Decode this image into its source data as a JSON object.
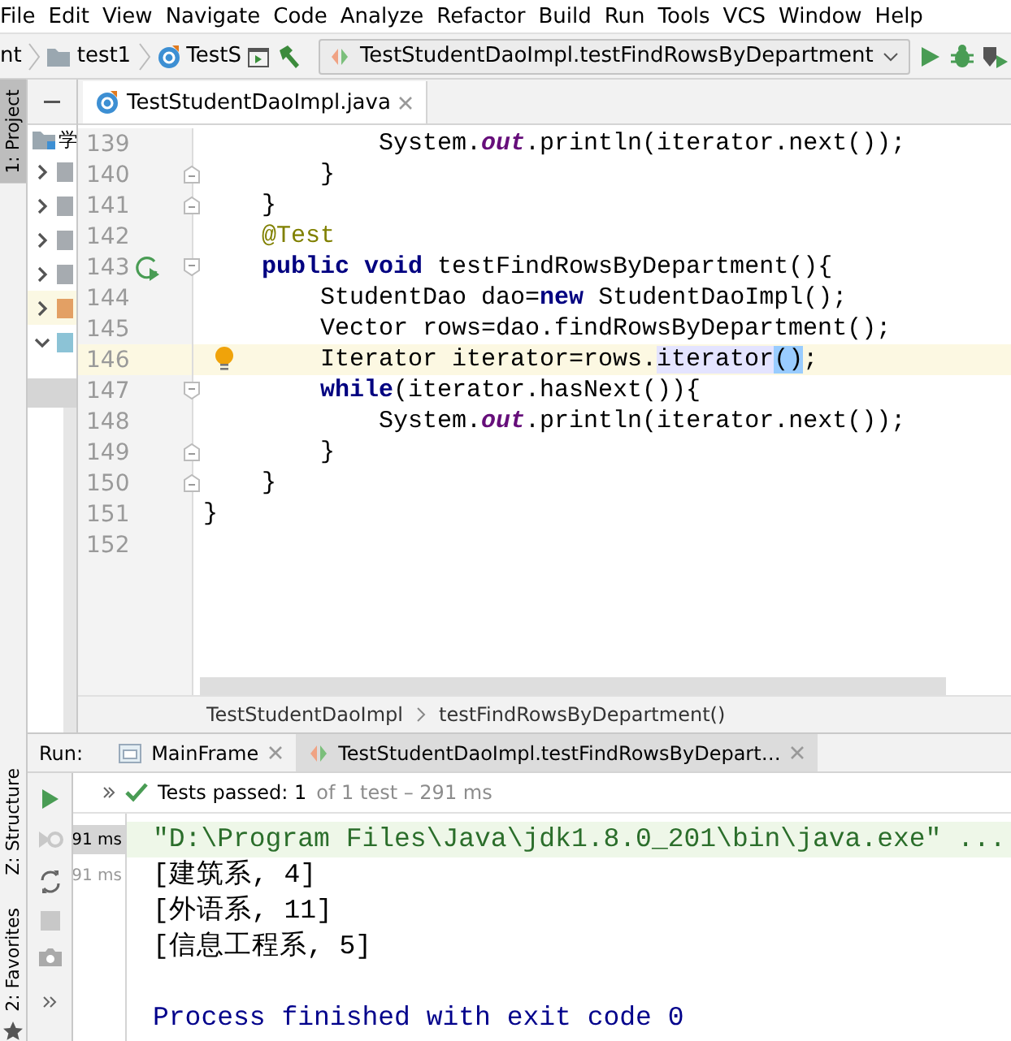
{
  "menu": [
    "File",
    "Edit",
    "View",
    "Navigate",
    "Code",
    "Analyze",
    "Refactor",
    "Build",
    "Run",
    "Tools",
    "VCS",
    "Window",
    "Help"
  ],
  "navbar": {
    "crumbs": [
      {
        "text": "nt",
        "kind": "module"
      },
      {
        "text": "test1",
        "kind": "folder"
      },
      {
        "text": "TestS",
        "kind": "class"
      }
    ],
    "run_config": "TestStudentDaoImpl.testFindRowsByDepartment"
  },
  "tool_tabs": [
    {
      "label": "1: Project",
      "selected": true,
      "kind": "project"
    },
    {
      "label": "Z: Structure",
      "selected": false,
      "kind": "structure"
    },
    {
      "label": "2: Favorites",
      "selected": false,
      "kind": "favorites"
    }
  ],
  "project_tree": {
    "root": "学",
    "rows": [
      {
        "expanded": false,
        "highlighted": false,
        "color": "#a6abb0"
      },
      {
        "expanded": false,
        "highlighted": false,
        "color": "#a6abb0"
      },
      {
        "expanded": false,
        "highlighted": false,
        "color": "#a6abb0"
      },
      {
        "expanded": false,
        "highlighted": false,
        "color": "#a6abb0"
      },
      {
        "expanded": false,
        "highlighted": true,
        "color": "#e3a064"
      },
      {
        "expanded": true,
        "highlighted": false,
        "color": "#8cc3d6"
      }
    ]
  },
  "editor": {
    "tabs": [
      {
        "label": "TestStudentDaoImpl.java",
        "selected": true
      }
    ],
    "lines": [
      {
        "number": "139",
        "current": false,
        "fold_open": false,
        "fold_close": false,
        "run_icon": false,
        "bulb": false,
        "tokens": [
          {
            "text": "            System.",
            "kind": "plain"
          },
          {
            "text": "out",
            "kind": "field"
          },
          {
            "text": ".println(iterator.next());",
            "kind": "plain"
          }
        ]
      },
      {
        "number": "140",
        "current": false,
        "fold_open": false,
        "fold_close": true,
        "run_icon": false,
        "bulb": false,
        "tokens": [
          {
            "text": "        }",
            "kind": "plain"
          }
        ]
      },
      {
        "number": "141",
        "current": false,
        "fold_open": false,
        "fold_close": true,
        "run_icon": false,
        "bulb": false,
        "tokens": [
          {
            "text": "    }",
            "kind": "plain"
          }
        ]
      },
      {
        "number": "142",
        "current": false,
        "fold_open": false,
        "fold_close": false,
        "run_icon": false,
        "bulb": false,
        "tokens": [
          {
            "text": "    @Test",
            "kind": "annotation"
          }
        ]
      },
      {
        "number": "143",
        "current": false,
        "fold_open": true,
        "fold_close": false,
        "run_icon": true,
        "bulb": false,
        "tokens": [
          {
            "text": "    public void",
            "kind": "keyword"
          },
          {
            "text": " testFindRowsByDepartment(){",
            "kind": "plain"
          }
        ]
      },
      {
        "number": "144",
        "current": false,
        "fold_open": false,
        "fold_close": false,
        "run_icon": false,
        "bulb": false,
        "tokens": [
          {
            "text": "        StudentDao dao=",
            "kind": "plain"
          },
          {
            "text": "new",
            "kind": "keyword"
          },
          {
            "text": " StudentDaoImpl();",
            "kind": "plain"
          }
        ]
      },
      {
        "number": "145",
        "current": false,
        "fold_open": false,
        "fold_close": false,
        "run_icon": false,
        "bulb": false,
        "tokens": [
          {
            "text": "        Vector rows=dao.findRowsByDepartment();",
            "kind": "plain"
          }
        ]
      },
      {
        "number": "146",
        "current": true,
        "fold_open": false,
        "fold_close": false,
        "run_icon": false,
        "bulb": true,
        "tokens": [
          {
            "text": "        Iterator iterator=rows.",
            "kind": "plain"
          },
          {
            "text": "iterator",
            "kind": "usage"
          },
          {
            "text": "()",
            "kind": "brace"
          },
          {
            "text": ";",
            "kind": "plain"
          }
        ]
      },
      {
        "number": "147",
        "current": false,
        "fold_open": true,
        "fold_close": false,
        "run_icon": false,
        "bulb": false,
        "tokens": [
          {
            "text": "        while",
            "kind": "keyword"
          },
          {
            "text": "(iterator.hasNext()){",
            "kind": "plain"
          }
        ]
      },
      {
        "number": "148",
        "current": false,
        "fold_open": false,
        "fold_close": false,
        "run_icon": false,
        "bulb": false,
        "tokens": [
          {
            "text": "            System.",
            "kind": "plain"
          },
          {
            "text": "out",
            "kind": "field"
          },
          {
            "text": ".println(iterator.next());",
            "kind": "plain"
          }
        ]
      },
      {
        "number": "149",
        "current": false,
        "fold_open": false,
        "fold_close": true,
        "run_icon": false,
        "bulb": false,
        "tokens": [
          {
            "text": "        }",
            "kind": "plain"
          }
        ]
      },
      {
        "number": "150",
        "current": false,
        "fold_open": false,
        "fold_close": true,
        "run_icon": false,
        "bulb": false,
        "tokens": [
          {
            "text": "    }",
            "kind": "plain"
          }
        ]
      },
      {
        "number": "151",
        "current": false,
        "fold_open": false,
        "fold_close": false,
        "run_icon": false,
        "bulb": false,
        "tokens": [
          {
            "text": "}",
            "kind": "plain"
          }
        ]
      },
      {
        "number": "152",
        "current": false,
        "fold_open": false,
        "fold_close": false,
        "run_icon": false,
        "bulb": false
      }
    ],
    "breadcrumbs": [
      "TestStudentDaoImpl",
      "testFindRowsByDepartment()"
    ]
  },
  "run": {
    "label": "Run:",
    "tabs": [
      {
        "label": "MainFrame",
        "selected": false,
        "kind": "app"
      },
      {
        "label": "TestStudentDaoImpl.testFindRowsByDepart…",
        "selected": true,
        "kind": "test"
      }
    ],
    "status": {
      "passed": "Tests passed: 1",
      "detail": "of 1 test – 291 ms"
    },
    "tests": [
      {
        "duration": "91 ms",
        "selected": true
      },
      {
        "duration": "91 ms",
        "selected": false
      }
    ],
    "console": [
      {
        "text": "\"D:\\Program Files\\Java\\jdk1.8.0_201\\bin\\java.exe\" ...",
        "kind": "command"
      },
      {
        "text": "[建筑系, 4]",
        "kind": "output"
      },
      {
        "text": "[外语系, 11]",
        "kind": "output"
      },
      {
        "text": "[信息工程系, 5]",
        "kind": "output"
      },
      {
        "text": "Process finished with exit code 0",
        "kind": "exit"
      }
    ]
  }
}
